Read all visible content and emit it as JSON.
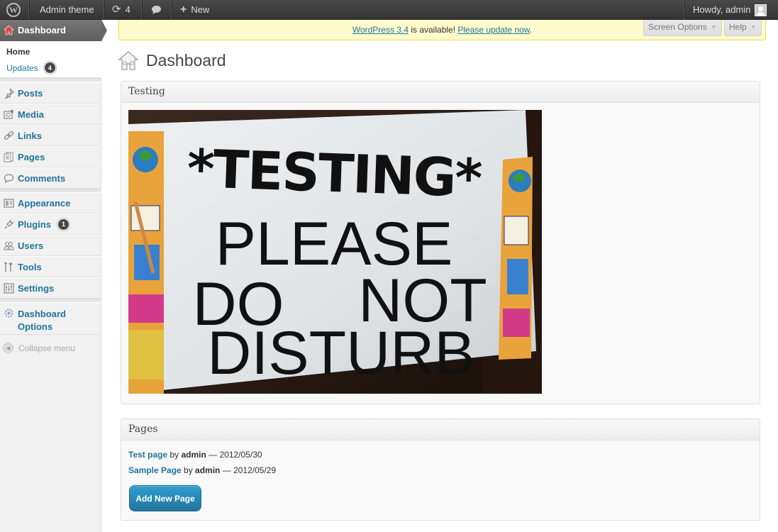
{
  "admin_bar": {
    "site_name": "Admin theme",
    "updates_count": "4",
    "new_label": "New",
    "greeting": "Howdy, admin"
  },
  "sidebar": {
    "current": "Dashboard",
    "submenu": [
      {
        "label": "Home"
      },
      {
        "label": "Updates",
        "badge": "4"
      }
    ],
    "items": [
      {
        "label": "Posts",
        "icon": "pushpin-icon"
      },
      {
        "label": "Media",
        "icon": "media-icon"
      },
      {
        "label": "Links",
        "icon": "link-icon"
      },
      {
        "label": "Pages",
        "icon": "pages-icon"
      },
      {
        "label": "Comments",
        "icon": "comment-icon"
      },
      {
        "label": "Appearance",
        "icon": "appearance-icon"
      },
      {
        "label": "Plugins",
        "icon": "plugin-icon",
        "badge": "1"
      },
      {
        "label": "Users",
        "icon": "users-icon"
      },
      {
        "label": "Tools",
        "icon": "tools-icon"
      },
      {
        "label": "Settings",
        "icon": "settings-icon"
      },
      {
        "label": "Dashboard Options",
        "icon": "gear-icon"
      }
    ],
    "collapse_label": "Collapse menu"
  },
  "notice": {
    "link1": "WordPress 3.4",
    "middle": " is available! ",
    "link2": "Please update now",
    "end": "."
  },
  "screen_meta": {
    "screen_options": "Screen Options",
    "help": "Help"
  },
  "page_title": "Dashboard",
  "widgets": {
    "testing": {
      "title": "Testing",
      "sign_lines": [
        "*TESTING*",
        "PLEASE",
        "DO",
        "NOT",
        "DISTURB"
      ]
    },
    "pages": {
      "title": "Pages",
      "rows": [
        {
          "title": "Test page",
          "by": " by ",
          "author": "admin",
          "date": " — 2012/05/30"
        },
        {
          "title": "Sample Page",
          "by": " by ",
          "author": "admin",
          "date": " — 2012/05/29"
        }
      ],
      "button": "Add New Page"
    }
  },
  "colors": {
    "link": "#21759b",
    "admin_bar": "#464646",
    "notice_bg": "#fffbcc"
  }
}
